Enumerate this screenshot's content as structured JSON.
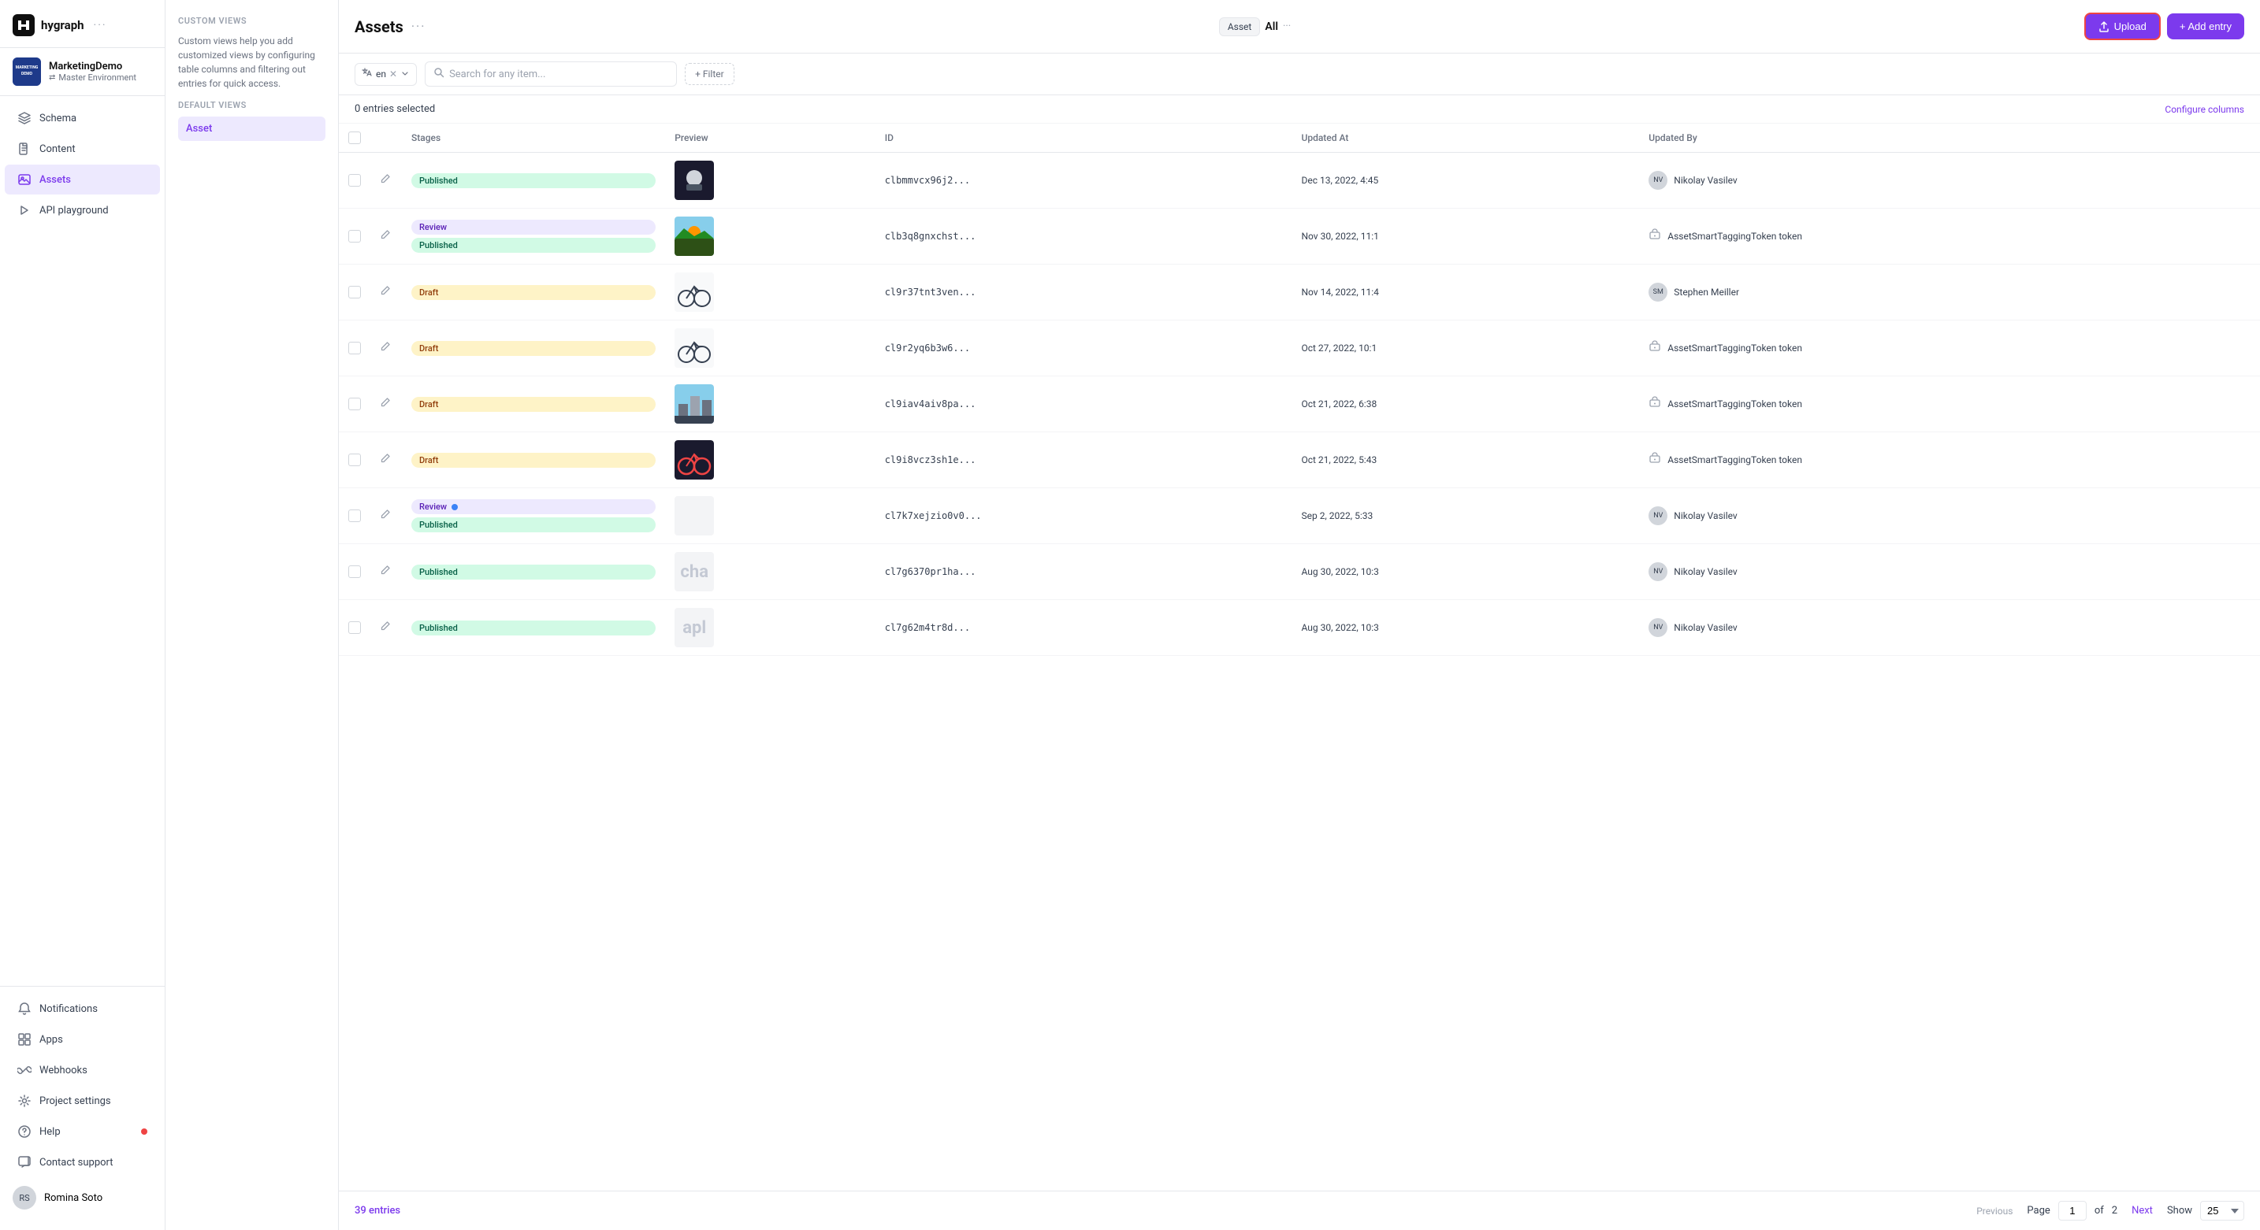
{
  "app": {
    "logo_text": "hygraph",
    "logo_dots": "···"
  },
  "project": {
    "name": "MarketingDemo",
    "env": "Master Environment",
    "avatar_text": "MARKETING"
  },
  "sidebar": {
    "nav_items": [
      {
        "id": "schema",
        "label": "Schema",
        "icon": "layers"
      },
      {
        "id": "content",
        "label": "Content",
        "icon": "file"
      },
      {
        "id": "assets",
        "label": "Assets",
        "icon": "image",
        "active": true
      },
      {
        "id": "api",
        "label": "API playground",
        "icon": "triangle"
      }
    ],
    "bottom_items": [
      {
        "id": "notifications",
        "label": "Notifications",
        "icon": "bell"
      },
      {
        "id": "apps",
        "label": "Apps",
        "icon": "grid"
      },
      {
        "id": "webhooks",
        "label": "Webhooks",
        "icon": "link"
      },
      {
        "id": "project-settings",
        "label": "Project settings",
        "icon": "settings"
      },
      {
        "id": "help",
        "label": "Help",
        "icon": "help-circle",
        "dot": true
      },
      {
        "id": "contact-support",
        "label": "Contact support",
        "icon": "message-square"
      }
    ],
    "user": {
      "name": "Romina Soto",
      "avatar_text": "RS"
    }
  },
  "views_panel": {
    "custom_views_title": "CUSTOM VIEWS",
    "custom_views_desc": "Custom views help you add customized views by configuring table columns and filtering out entries for quick access.",
    "default_views_title": "DEFAULT VIEWS",
    "default_views": [
      {
        "id": "asset",
        "label": "Asset",
        "active": true
      }
    ]
  },
  "header": {
    "title": "Assets",
    "dots": "···",
    "tab_asset": "Asset",
    "tab_all": "All",
    "tab_more_dots": "···",
    "btn_upload": "Upload",
    "btn_add_entry": "+ Add entry"
  },
  "toolbar": {
    "lang": "en",
    "search_placeholder": "Search for any item...",
    "filter_label": "+ Filter",
    "selected_label": "0 entries selected",
    "configure_label": "Configure columns"
  },
  "table": {
    "columns": [
      {
        "id": "checkbox",
        "label": ""
      },
      {
        "id": "edit",
        "label": ""
      },
      {
        "id": "stages",
        "label": "Stages"
      },
      {
        "id": "preview",
        "label": "Preview"
      },
      {
        "id": "id",
        "label": "ID"
      },
      {
        "id": "updated_at",
        "label": "Updated At"
      },
      {
        "id": "updated_by",
        "label": "Updated By"
      }
    ],
    "rows": [
      {
        "stages": [
          "Published"
        ],
        "preview_type": "image",
        "preview_style": "space",
        "id": "clbmmvcx96j2...",
        "updated_at": "Dec 13, 2022, 4:45",
        "updated_by_type": "user",
        "updated_by": "Nikolay Vasilev",
        "avatar": "NV"
      },
      {
        "stages": [
          "Review",
          "Published"
        ],
        "preview_type": "image",
        "preview_style": "sunset",
        "id": "clb3q8gnxchst...",
        "updated_at": "Nov 30, 2022, 11:1",
        "updated_by_type": "token",
        "updated_by": "AssetSmartTaggingToken token",
        "avatar": ""
      },
      {
        "stages": [
          "Draft"
        ],
        "preview_type": "image",
        "preview_style": "bike",
        "id": "cl9r37tnt3ven...",
        "updated_at": "Nov 14, 2022, 11:4",
        "updated_by_type": "user",
        "updated_by": "Stephen Meiller",
        "avatar": "SM"
      },
      {
        "stages": [
          "Draft"
        ],
        "preview_type": "image",
        "preview_style": "bike2",
        "id": "cl9r2yq6b3w6...",
        "updated_at": "Oct 27, 2022, 10:1",
        "updated_by_type": "token",
        "updated_by": "AssetSmartTaggingToken token",
        "avatar": ""
      },
      {
        "stages": [
          "Draft"
        ],
        "preview_type": "image",
        "preview_style": "city",
        "id": "cl9iav4aiv8pa...",
        "updated_at": "Oct 21, 2022, 6:38",
        "updated_by_type": "token",
        "updated_by": "AssetSmartTaggingToken token",
        "avatar": ""
      },
      {
        "stages": [
          "Draft"
        ],
        "preview_type": "image",
        "preview_style": "bike3",
        "id": "cl9i8vcz3sh1e...",
        "updated_at": "Oct 21, 2022, 5:43",
        "updated_by_type": "token",
        "updated_by": "AssetSmartTaggingToken token",
        "avatar": ""
      },
      {
        "stages": [
          "Review",
          "Published"
        ],
        "preview_type": "none",
        "preview_style": "",
        "id": "cl7k7xejzio0v0...",
        "updated_at": "Sep 2, 2022, 5:33",
        "updated_by_type": "user",
        "updated_by": "Nikolay Vasilev",
        "avatar": "NV",
        "review_dot": true
      },
      {
        "stages": [
          "Published"
        ],
        "preview_type": "text",
        "preview_text": "cha",
        "preview_style": "text-cha",
        "id": "cl7g6370pr1ha...",
        "updated_at": "Aug 30, 2022, 10:3",
        "updated_by_type": "user",
        "updated_by": "Nikolay Vasilev",
        "avatar": "NV"
      },
      {
        "stages": [
          "Published"
        ],
        "preview_type": "text",
        "preview_text": "apl",
        "preview_style": "text-apl",
        "id": "cl7g62m4tr8d...",
        "updated_at": "Aug 30, 2022, 10:3",
        "updated_by_type": "user",
        "updated_by": "Nikolay Vasilev",
        "avatar": "NV"
      }
    ]
  },
  "footer": {
    "entries_count": "39 entries",
    "prev_label": "Previous",
    "page_label": "Page",
    "page_current": "1",
    "page_of": "of",
    "page_total": "2",
    "next_label": "Next",
    "show_label": "Show",
    "show_value": "25"
  }
}
